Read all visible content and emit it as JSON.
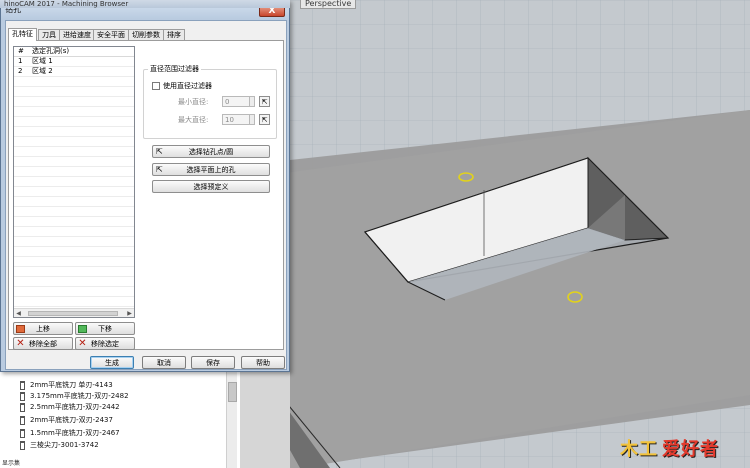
{
  "app": {
    "title": "hinoCAM 2017 - Machining Browser",
    "viewport_label": "Perspective"
  },
  "dialog": {
    "title": "钻孔",
    "close_label": "X",
    "tabs": [
      {
        "label": "孔特征",
        "active": true
      },
      {
        "label": "刀具"
      },
      {
        "label": "进给速度"
      },
      {
        "label": "安全平面"
      },
      {
        "label": "切削参数"
      },
      {
        "label": "排序"
      }
    ],
    "hole_list": {
      "headers": [
        "#",
        "选定孔洞(s)"
      ],
      "rows": [
        {
          "num": "1",
          "name": "区域 1"
        },
        {
          "num": "2",
          "name": "区域 2"
        }
      ]
    },
    "list_buttons": {
      "move_up": "上移",
      "move_down": "下移",
      "remove_all": "移除全部",
      "remove_selected": "移除选定"
    },
    "diameter_filter": {
      "group_label": "直径范围过滤器",
      "checkbox_label": "使用直径过滤器",
      "checked": false,
      "min_label": "最小直径:",
      "min_value": "0",
      "max_label": "最大直径:",
      "max_value": "10"
    },
    "select_buttons": {
      "select_drill_points": "选择钻孔点/圆",
      "select_holes_on_plane": "选择平面上的孔",
      "select_custom": "选择预定义"
    },
    "footer": {
      "generate": "生成",
      "cancel": "取消",
      "save": "保存",
      "help": "帮助"
    }
  },
  "browser": {
    "tools": [
      "2mm平底铣刀 单刃-4143",
      "3.175mm平底铣刀-双刃-2482",
      "2.5mm平底铣刀-双刃-2442",
      "2mm平底铣刀-双刃-2437",
      "1.5mm平底铣刀-双刃-2467",
      "三棱尖刀-3001-3742"
    ],
    "footer_text": "显示集"
  },
  "watermark": {
    "text": "爱好者",
    "mark": "木工"
  }
}
